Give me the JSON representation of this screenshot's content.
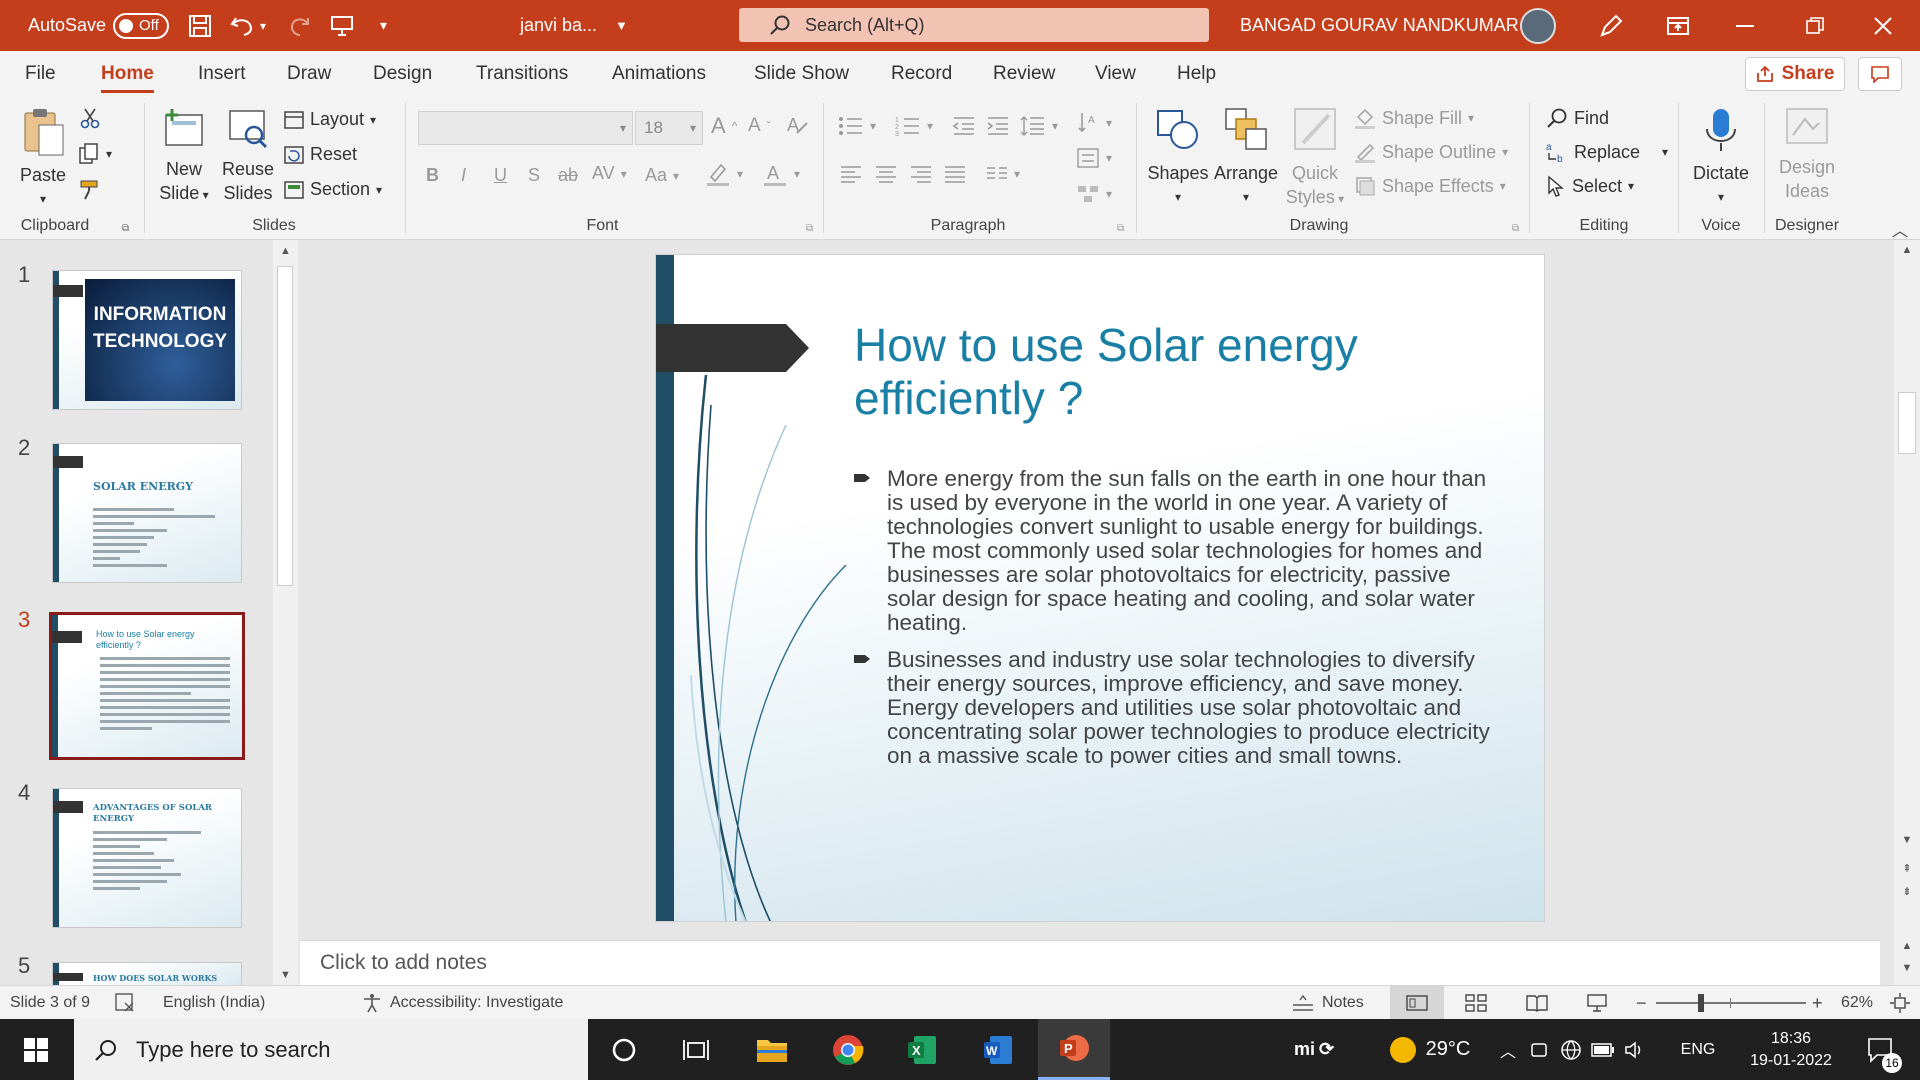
{
  "titlebar": {
    "autosave_label": "AutoSave",
    "autosave_state": "Off",
    "filename": "janvi ba...",
    "search_placeholder": "Search (Alt+Q)",
    "user_name": "BANGAD GOURAV NANDKUMAR"
  },
  "tabs": [
    "File",
    "Home",
    "Insert",
    "Draw",
    "Design",
    "Transitions",
    "Animations",
    "Slide Show",
    "Record",
    "Review",
    "View",
    "Help"
  ],
  "share_label": "Share",
  "ribbon": {
    "clipboard": {
      "paste": "Paste",
      "label": "Clipboard"
    },
    "slides": {
      "new_slide_1": "New",
      "new_slide_2": "Slide",
      "reuse_1": "Reuse",
      "reuse_2": "Slides",
      "layout": "Layout",
      "reset": "Reset",
      "section": "Section",
      "label": "Slides"
    },
    "font": {
      "size": "18",
      "bold": "B",
      "italic": "I",
      "underline": "U",
      "shadow": "S",
      "strike": "ab",
      "spacing": "AV",
      "case": "Aa",
      "label": "Font"
    },
    "paragraph": {
      "label": "Paragraph"
    },
    "drawing": {
      "shapes": "Shapes",
      "arrange": "Arrange",
      "quick_1": "Quick",
      "quick_2": "Styles",
      "shape_fill": "Shape Fill",
      "shape_outline": "Shape Outline",
      "shape_effects": "Shape Effects",
      "label": "Drawing"
    },
    "editing": {
      "find": "Find",
      "replace": "Replace",
      "select": "Select",
      "label": "Editing"
    },
    "voice": {
      "dictate": "Dictate",
      "label": "Voice"
    },
    "designer": {
      "ideas_1": "Design",
      "ideas_2": "Ideas",
      "label": "Designer"
    }
  },
  "thumbnails": [
    {
      "num": "1",
      "title_1": "INFORMATION",
      "title_2": "TECHNOLOGY"
    },
    {
      "num": "2",
      "title": "SOLAR ENERGY"
    },
    {
      "num": "3",
      "title": "How to use Solar energy efficiently ?"
    },
    {
      "num": "4",
      "title": "ADVANTAGES OF SOLAR ENERGY"
    },
    {
      "num": "5",
      "title": "HOW DOES SOLAR WORKS"
    }
  ],
  "slide": {
    "title": "How to use Solar energy efficiently ?",
    "bullets": [
      "More energy from the sun falls on the earth in one hour than is used by everyone in the world in one year. A variety of technologies convert sunlight to usable energy for buildings. The most commonly used solar technologies for homes and businesses are solar photovoltaics for electricity, passive solar design for space heating and cooling, and solar water heating.",
      "Businesses and industry use solar technologies to diversify their energy sources, improve efficiency, and save money. Energy developers and utilities use solar photovoltaic and concentrating solar power technologies to produce electricity on a massive scale to power cities and small towns."
    ]
  },
  "notes_placeholder": "Click to add notes",
  "statusbar": {
    "slide_info": "Slide 3 of 9",
    "language": "English (India)",
    "accessibility": "Accessibility: Investigate",
    "notes": "Notes",
    "zoom": "62%"
  },
  "taskbar": {
    "search_placeholder": "Type here to search",
    "temperature": "29°C",
    "language": "ENG",
    "time": "18:36",
    "date": "19-01-2022",
    "notifications": "16"
  },
  "colors": {
    "accent": "#c43e1c",
    "title_blue": "#1a7fa5",
    "slide_bar": "#1f4e66"
  }
}
